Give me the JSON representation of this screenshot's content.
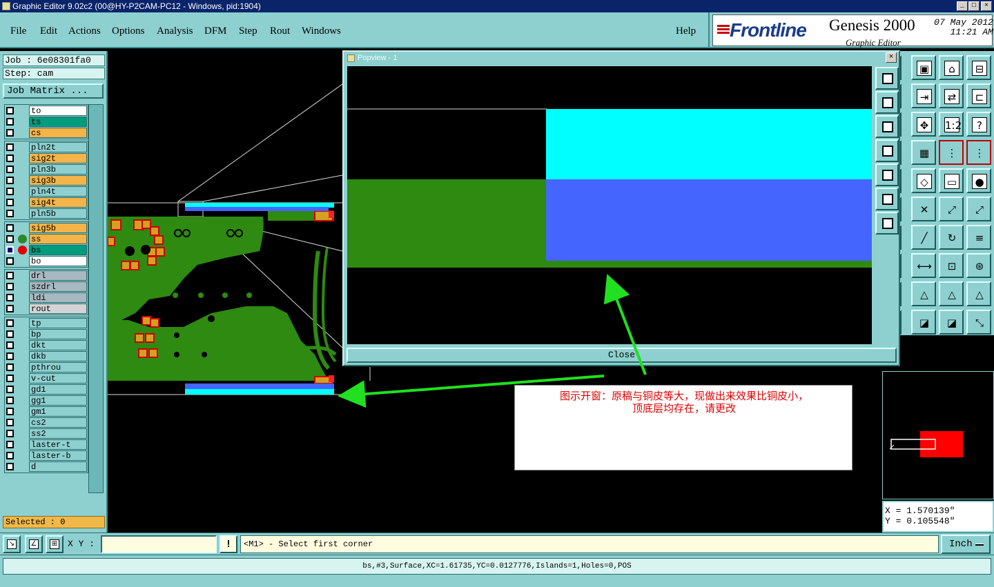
{
  "window": {
    "title": "Graphic Editor 9.02c2 (00@HY-P2CAM-PC12 - Windows, pid:1904)",
    "min": "_",
    "max": "□",
    "close": "×"
  },
  "menu": {
    "items": [
      "File",
      "Edit",
      "Actions",
      "Options",
      "Analysis",
      "DFM",
      "Step",
      "Rout",
      "Windows"
    ],
    "help": "Help"
  },
  "logo": {
    "brand": "Frontline",
    "product": "Genesis 2000",
    "subtitle": "Graphic Editor",
    "date": "07 May 2012",
    "time": "11:21 AM"
  },
  "job": {
    "job": "Job : 6e08301fa0",
    "step": "Step: cam",
    "matrix_button": "Job Matrix ..."
  },
  "layers": [
    {
      "name": "to",
      "color": "#ffffff",
      "checked": false,
      "dot": ""
    },
    {
      "name": "ts",
      "color": "#009c7c",
      "checked": false,
      "dot": ""
    },
    {
      "name": "cs",
      "color": "#f4b448",
      "checked": false,
      "dot": ""
    },
    {
      "name": "pln2t",
      "color": "#8ed0d0",
      "checked": false,
      "dot": ""
    },
    {
      "name": "sig2t",
      "color": "#f4b448",
      "checked": false,
      "dot": ""
    },
    {
      "name": "pln3b",
      "color": "#8ed0d0",
      "checked": false,
      "dot": ""
    },
    {
      "name": "sig3b",
      "color": "#f4b448",
      "checked": false,
      "dot": ""
    },
    {
      "name": "pln4t",
      "color": "#8ed0d0",
      "checked": false,
      "dot": ""
    },
    {
      "name": "sig4t",
      "color": "#f4b448",
      "checked": false,
      "dot": ""
    },
    {
      "name": "pln5b",
      "color": "#8ed0d0",
      "checked": false,
      "dot": ""
    },
    {
      "name": "sig5b",
      "color": "#f4b448",
      "checked": false,
      "dot": ""
    },
    {
      "name": "ss",
      "color": "#f4b448",
      "checked": false,
      "dot": "#2a8a2a"
    },
    {
      "name": "bs",
      "color": "#009c7c",
      "checked": true,
      "dot": "#e00000"
    },
    {
      "name": "bo",
      "color": "#ffffff",
      "checked": false,
      "dot": ""
    },
    {
      "name": "drl",
      "color": "#a8b8c0",
      "checked": false,
      "dot": ""
    },
    {
      "name": "szdrl",
      "color": "#a8b8c0",
      "checked": false,
      "dot": ""
    },
    {
      "name": "ldi",
      "color": "#a8b8c0",
      "checked": false,
      "dot": ""
    },
    {
      "name": "rout",
      "color": "#d4d4d4",
      "checked": false,
      "dot": ""
    },
    {
      "name": "tp",
      "color": "#8ed0d0",
      "checked": false,
      "dot": ""
    },
    {
      "name": "bp",
      "color": "#8ed0d0",
      "checked": false,
      "dot": ""
    },
    {
      "name": "dkt",
      "color": "#8ed0d0",
      "checked": false,
      "dot": ""
    },
    {
      "name": "dkb",
      "color": "#8ed0d0",
      "checked": false,
      "dot": ""
    },
    {
      "name": "pthrou",
      "color": "#8ed0d0",
      "checked": false,
      "dot": ""
    },
    {
      "name": "v-cut",
      "color": "#8ed0d0",
      "checked": false,
      "dot": ""
    },
    {
      "name": "gd1",
      "color": "#8ed0d0",
      "checked": false,
      "dot": ""
    },
    {
      "name": "gg1",
      "color": "#8ed0d0",
      "checked": false,
      "dot": ""
    },
    {
      "name": "gm1",
      "color": "#8ed0d0",
      "checked": false,
      "dot": ""
    },
    {
      "name": "cs2",
      "color": "#8ed0d0",
      "checked": false,
      "dot": ""
    },
    {
      "name": "ss2",
      "color": "#8ed0d0",
      "checked": false,
      "dot": ""
    },
    {
      "name": "laster-t",
      "color": "#8ed0d0",
      "checked": false,
      "dot": ""
    },
    {
      "name": "laster-b",
      "color": "#8ed0d0",
      "checked": false,
      "dot": ""
    },
    {
      "name": "d",
      "color": "#8ed0d0",
      "checked": false,
      "dot": ""
    }
  ],
  "selected": "Selected : 0",
  "popview": {
    "title": "Popview - 1",
    "close_button": "Close",
    "close_x": "×"
  },
  "annotation": {
    "text_line1": "图示开窗：原稿与铜皮等大，现做出来效果比铜皮小，",
    "text_line2": "顶底层均存在，请更改"
  },
  "coords": {
    "x": "X = 1.570139\"",
    "y": "Y = 0.105548\""
  },
  "command": {
    "xy_label": "X Y :",
    "xy_value": "",
    "warn": "!",
    "prompt": "<M1> - Select first corner",
    "unit": "Inch"
  },
  "status": "bs,#3,Surface,XC=1.61735,YC=0.0127776,Islands=1,Holes=0,POS",
  "colors": {
    "panel": "#8ed0d0",
    "copper": "#2e8a10",
    "pad": "#d4a020",
    "cyan": "#00ffff",
    "blue": "#4466ff",
    "arrow": "#20e020",
    "note_text": "#e00000"
  }
}
